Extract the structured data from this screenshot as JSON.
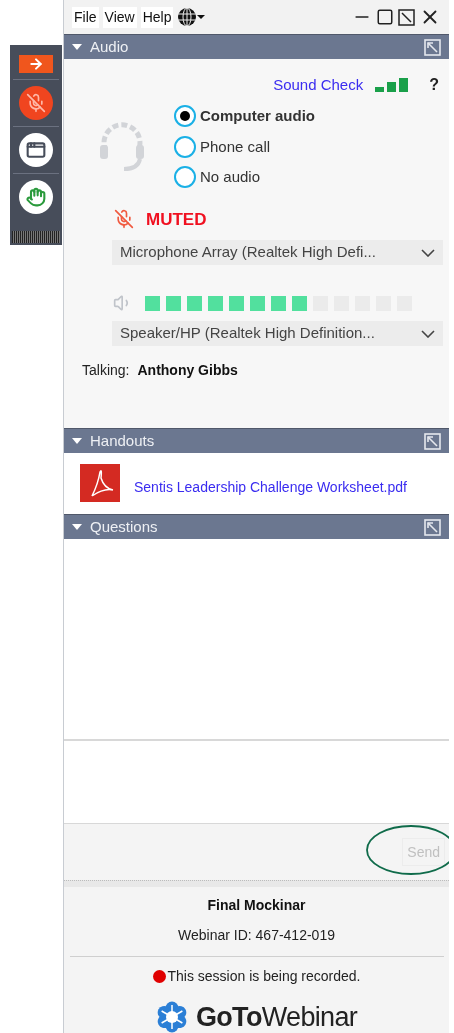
{
  "menu": [
    {
      "label": "File"
    },
    {
      "label": "View"
    },
    {
      "label": "Help"
    }
  ],
  "audio": {
    "title": "Audio",
    "expanded": true,
    "sound_check": "Sound Check",
    "help": "?",
    "options": [
      {
        "label": "Computer audio",
        "selected": true
      },
      {
        "label": "Phone call",
        "selected": false
      },
      {
        "label": "No audio",
        "selected": false
      }
    ],
    "muted": true,
    "mic_status": "MUTED",
    "microphone": "Microphone Array (Realtek High Defi...",
    "level": 0.615,
    "speaker": "Speaker/HP (Realtek High Definition...",
    "talking_label": "Talking:",
    "talking_name": "Anthony Gibbs"
  },
  "handouts": {
    "title": "Handouts",
    "expanded": true,
    "files": [
      {
        "name": "Sentis Leadership Challenge Worksheet.pdf"
      }
    ]
  },
  "questions": {
    "title": "Questions",
    "expanded": true,
    "send": "Send",
    "send_disabled": true
  },
  "footer": {
    "webinar_title": "Final Mockinar",
    "webinar_id": "Webinar ID: 467-412-019",
    "recording": "This session is being recorded.",
    "logo": "**GoTo**Webinar"
  }
}
